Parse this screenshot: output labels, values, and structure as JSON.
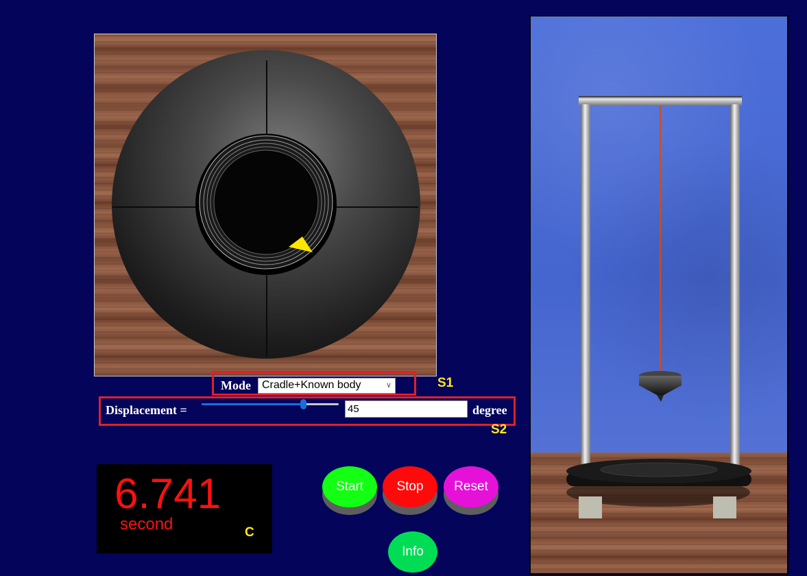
{
  "controls": {
    "mode_label": "Mode",
    "mode_value": "Cradle+Known body",
    "displacement_label": "Displacement =",
    "displacement_value": "45",
    "displacement_unit": "degree",
    "slider_fraction": 0.74
  },
  "tags": {
    "s1": "S1",
    "s2": "S2",
    "c": "C"
  },
  "timer": {
    "value": "6.741",
    "unit": "second"
  },
  "buttons": {
    "start": "Start",
    "stop": "Stop",
    "reset": "Reset",
    "info": "Info"
  },
  "colors": {
    "background": "#03045a",
    "highlight_box": "#e0202a",
    "tag": "#ffe81a",
    "timer_text": "#ff1010",
    "start": "#13ff13",
    "stop": "#ff0a0a",
    "reset": "#e611d8",
    "info": "#00dd55",
    "pointer": "#ffe600",
    "wire": "#d24a1e"
  }
}
